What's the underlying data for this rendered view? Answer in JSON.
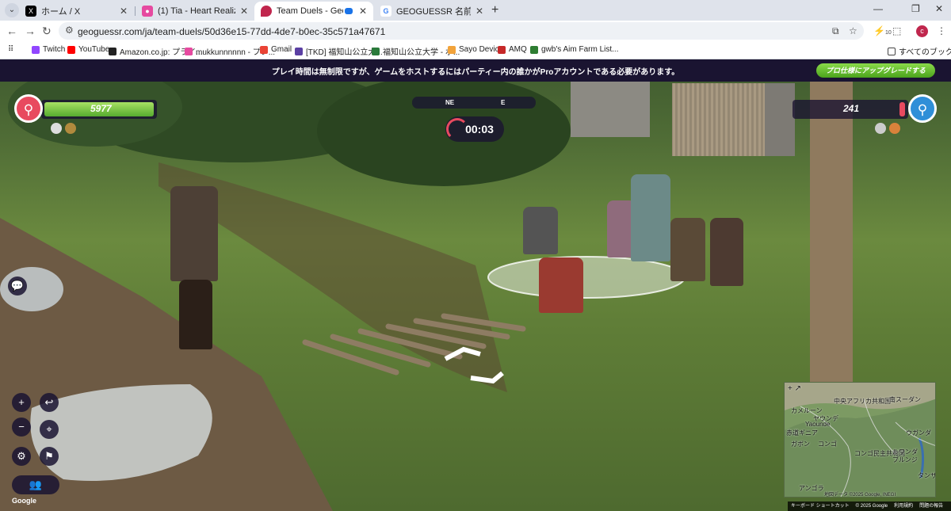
{
  "browser": {
    "tabs": [
      {
        "title": "ホーム / X",
        "icon": "x-logo-icon",
        "active": false
      },
      {
        "title": "(1) Tia - Heart Realize (TV Size)",
        "icon": "youtube-icon",
        "active": false
      },
      {
        "title": "Team Duels - GeoGuessr",
        "icon": "geoguessr-pin-icon",
        "active": true
      },
      {
        "title": "GEOGUESSR 名前変更 - Google",
        "icon": "google-icon",
        "active": false
      }
    ],
    "url": "geoguessr.com/ja/team-duels/50d36e15-77dd-4de7-b0ec-35c571a47671",
    "extension_badge": "10",
    "profile_initial": "c",
    "bookmarks": [
      {
        "label": "Twitch",
        "color": "#9146ff"
      },
      {
        "label": "YouTube",
        "color": "#ff0000"
      },
      {
        "label": "Amazon.co.jp: プライ...",
        "color": "#222222"
      },
      {
        "label": "mukkunnnnnn - プレ...",
        "color": "#e64aa0"
      },
      {
        "label": "Gmail",
        "color": "#ea4335"
      },
      {
        "label": "[TKD] 福知山公立大...",
        "color": "#5b3fa3"
      },
      {
        "label": "福知山公立大学 - ポ...",
        "color": "#2a7a3b"
      },
      {
        "label": "Sayo Device",
        "color": "#f2a33a"
      },
      {
        "label": "AMQ",
        "color": "#c62828"
      },
      {
        "label": "gwb's Aim Farm List...",
        "color": "#2e7d32"
      }
    ],
    "all_bookmarks_label": "すべてのブックマーク"
  },
  "game": {
    "promo_text": "プレイ時間は無制限ですが、ゲームをホストするにはパーティー内の誰かがProアカウントである必要があります。",
    "upgrade_label": "プロ仕様にアップグレードする",
    "left_team": {
      "health": 5977,
      "health_fraction": 1.0,
      "color": "#e84a5f"
    },
    "right_team": {
      "health": 241,
      "health_fraction": 0.05,
      "color": "#2f8fd8"
    },
    "compass": {
      "ne": "NE",
      "e": "E"
    },
    "timer": "00:03",
    "minimap": {
      "labels": [
        "中央アフリカ共和国",
        "南スーダン",
        "カメルーン",
        "ヤウンデ",
        "Yaounde",
        "ウガンダ",
        "赤道ギニア",
        "ガボン",
        "コンゴ",
        "コンゴ民主共和国",
        "ルワンダ",
        "ブルンジ",
        "タンザ",
        "アンゴラ"
      ]
    },
    "footer": {
      "keyboard": "キーボード ショートカット",
      "copyright": "© 2025 Google",
      "terms": "利用規約",
      "report": "問題の報告",
      "map_data": "地図データ ©2025 Google, INEGI"
    },
    "attribution": "Google"
  }
}
